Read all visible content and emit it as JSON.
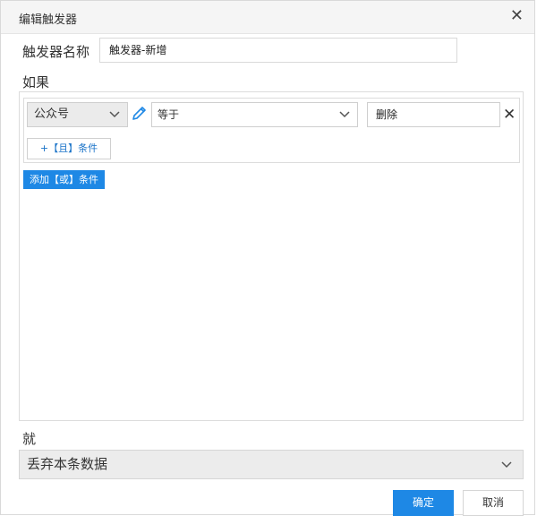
{
  "window": {
    "title": "编辑触发器",
    "close_icon": "close-icon"
  },
  "trigger": {
    "name_label": "触发器名称",
    "name_value": "触发器-新增"
  },
  "if_section": {
    "label": "如果",
    "conditions": [
      {
        "field": "公众号",
        "operator": "等于",
        "value": "删除"
      }
    ],
    "add_and_label": "+【且】条件",
    "add_or_label": "添加【或】条件",
    "colors": {
      "accent": "#1e88e5"
    }
  },
  "then_section": {
    "label": "就",
    "action": "丢弃本条数据"
  },
  "footer": {
    "ok_label": "确定",
    "cancel_label": "取消"
  }
}
